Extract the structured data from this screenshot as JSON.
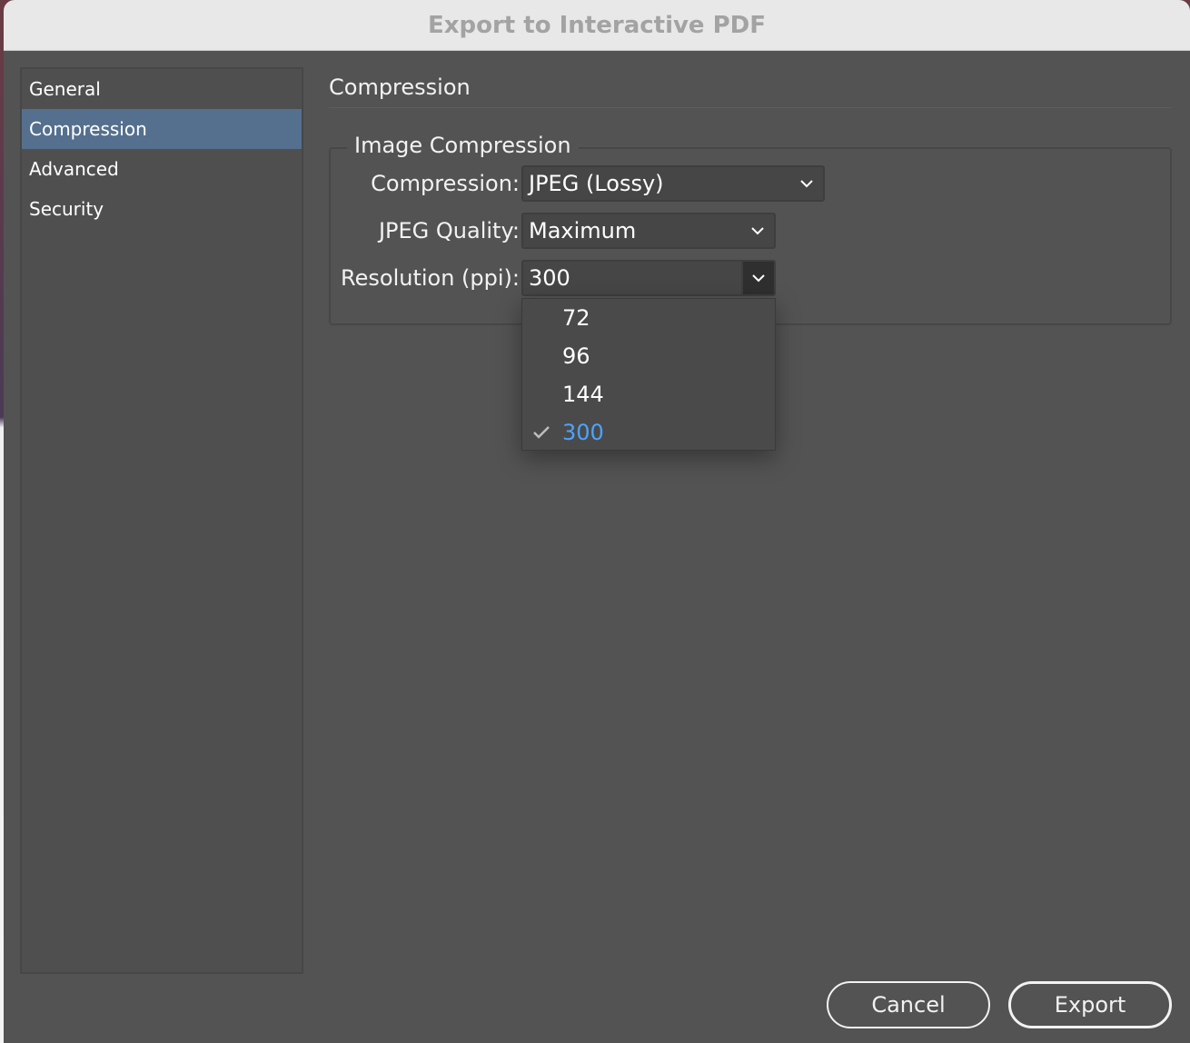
{
  "window": {
    "title": "Export to Interactive PDF"
  },
  "sidebar": {
    "items": [
      {
        "label": "General",
        "selected": false
      },
      {
        "label": "Compression",
        "selected": true
      },
      {
        "label": "Advanced",
        "selected": false
      },
      {
        "label": "Security",
        "selected": false
      }
    ]
  },
  "main": {
    "section_title": "Compression",
    "group": {
      "legend": "Image Compression",
      "compression": {
        "label": "Compression:",
        "value": "JPEG (Lossy)"
      },
      "jpeg_quality": {
        "label": "JPEG Quality:",
        "value": "Maximum"
      },
      "resolution": {
        "label": "Resolution (ppi):",
        "value": "300"
      }
    }
  },
  "resolution_dropdown": {
    "open": true,
    "options": [
      "72",
      "96",
      "144",
      "300"
    ],
    "selected": "300"
  },
  "buttons": {
    "cancel": "Cancel",
    "export": "Export"
  },
  "colors": {
    "panel": "#535353",
    "sidebar_selected": "#54708e",
    "selected_option": "#4da3ff",
    "title_text": "#a3a3a3"
  },
  "icons": {
    "dropdown": "chevron-down-icon",
    "check": "checkmark-icon"
  }
}
